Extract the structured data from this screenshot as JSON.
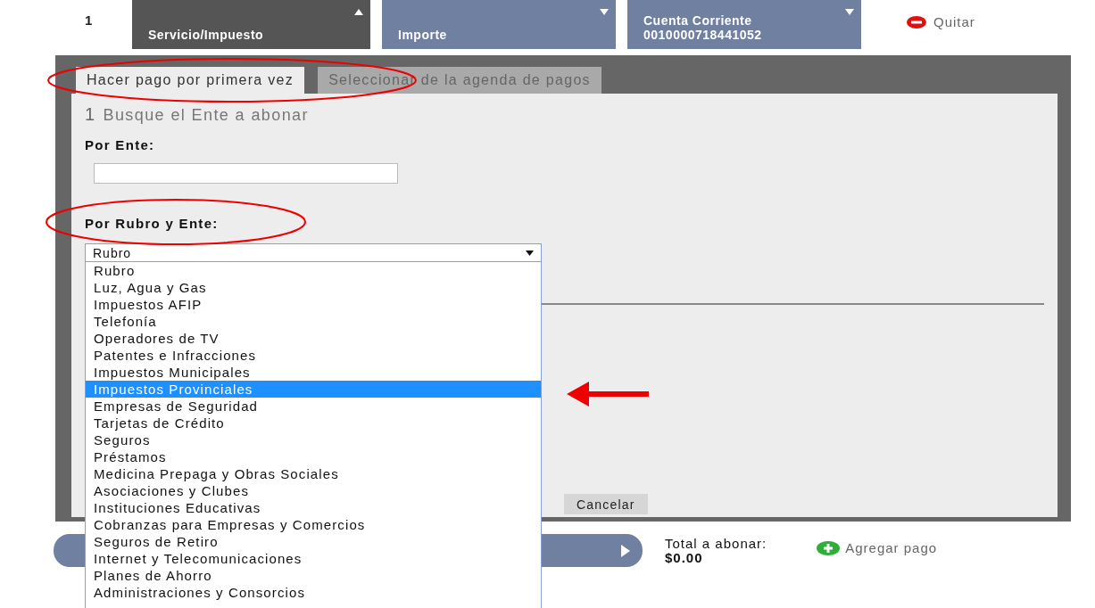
{
  "top_row": {
    "index": "1",
    "fields": [
      {
        "kind": "dark",
        "label": "Servicio/Impuesto"
      },
      {
        "kind": "light",
        "label": "Importe"
      },
      {
        "kind": "light",
        "label": "Cuenta Corriente",
        "value": "0010000718441052"
      }
    ],
    "remove": "Quitar"
  },
  "tabs": [
    {
      "label": "Hacer pago por primera vez",
      "selected": true
    },
    {
      "label": "Seleccionar de la agenda de pagos",
      "selected": false
    }
  ],
  "step": {
    "number": "1",
    "title": "Busque el Ente a abonar"
  },
  "por_ente": {
    "label": "Por Ente:"
  },
  "por_rubro": {
    "label": "Por Rubro y Ente:",
    "select_value": "Rubro",
    "options": [
      {
        "label": "Rubro",
        "selected": false
      },
      {
        "label": "Luz, Agua y Gas",
        "selected": false
      },
      {
        "label": "Impuestos AFIP",
        "selected": false
      },
      {
        "label": "Telefonía",
        "selected": false
      },
      {
        "label": "Operadores de TV",
        "selected": false
      },
      {
        "label": "Patentes e Infracciones",
        "selected": false
      },
      {
        "label": "Impuestos Municipales",
        "selected": false
      },
      {
        "label": "Impuestos Provinciales",
        "selected": true
      },
      {
        "label": "Empresas de Seguridad",
        "selected": false
      },
      {
        "label": "Tarjetas de Crédito",
        "selected": false
      },
      {
        "label": "Seguros",
        "selected": false
      },
      {
        "label": "Préstamos",
        "selected": false
      },
      {
        "label": "Medicina Prepaga y Obras Sociales",
        "selected": false
      },
      {
        "label": "Asociaciones y Clubes",
        "selected": false
      },
      {
        "label": "Instituciones Educativas",
        "selected": false
      },
      {
        "label": "Cobranzas para Empresas y Comercios",
        "selected": false
      },
      {
        "label": "Seguros de Retiro",
        "selected": false
      },
      {
        "label": "Internet y Telecomunicaciones",
        "selected": false
      },
      {
        "label": "Planes de Ahorro",
        "selected": false
      },
      {
        "label": "Administraciones y Consorcios",
        "selected": false
      }
    ]
  },
  "buttons": [
    {
      "label": "Cancelar"
    }
  ],
  "total": {
    "label": "Total a abonar:",
    "value": "$0.00"
  },
  "add_payment": "Agregar pago"
}
